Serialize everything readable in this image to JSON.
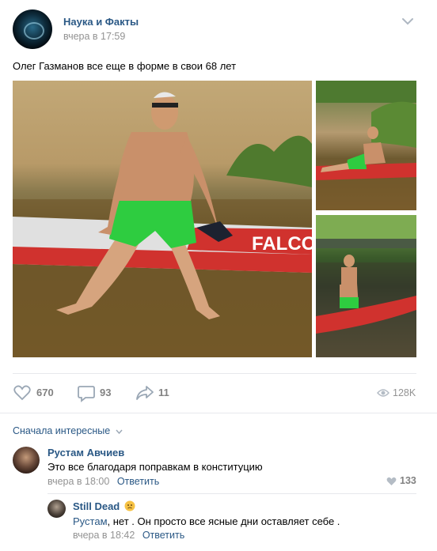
{
  "post": {
    "author": "Наука и Факты",
    "time": "вчера в 17:59",
    "text": "Олег Газманов все еще в форме в свои 68 лет",
    "board_text": "FALCO",
    "likes": "670",
    "comments": "93",
    "shares": "11",
    "views": "128K"
  },
  "comments_section": {
    "sort_label": "Сначала интересные",
    "comments": [
      {
        "author": "Рустам Авчиев",
        "text": "Это все благодаря поправкам в конституцию",
        "time": "вчера в 18:00",
        "reply_label": "Ответить",
        "likes": "133"
      },
      {
        "author": "Still Dead",
        "reply_to": "Рустам",
        "text": ", нет . Он просто все ясные дни оставляет себе .",
        "time": "вчера в 18:42",
        "reply_label": "Ответить"
      }
    ]
  },
  "colors": {
    "link": "#2a5885",
    "muted": "#828282",
    "divider": "#e7e8ec"
  },
  "icons": [
    "heart-icon",
    "comment-icon",
    "share-icon",
    "eye-icon",
    "chevron-down-icon",
    "emoji-icon"
  ]
}
